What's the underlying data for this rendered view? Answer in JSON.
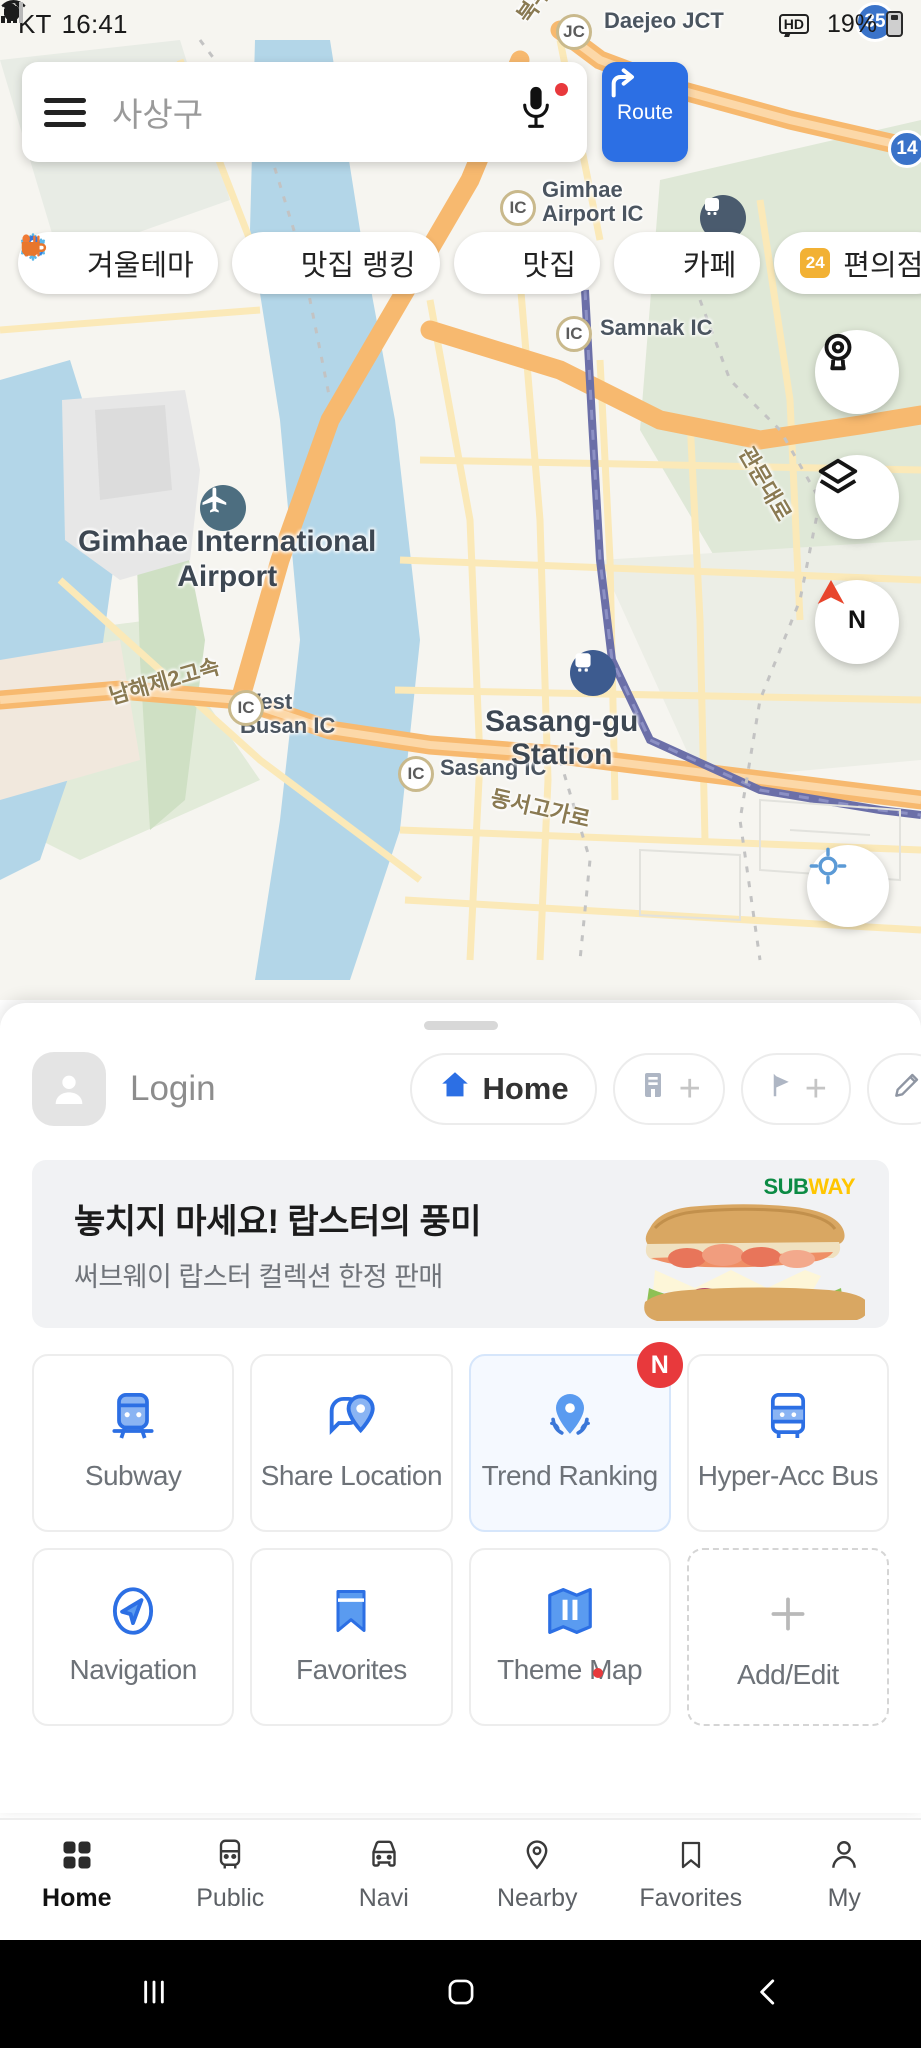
{
  "status_bar": {
    "carrier": "KT",
    "time": "16:41",
    "hd_label": "HD",
    "battery_percent": "19%",
    "icons": [
      "alarm-icon",
      "mute-icon",
      "location-icon",
      "wifi-icon",
      "hd-icon",
      "signal-icon"
    ]
  },
  "search": {
    "menu_icon": "hamburger-menu-icon",
    "value": "사상구",
    "placeholder": "사상구",
    "mic_icon": "microphone-icon",
    "has_notification_dot": true
  },
  "route_button": {
    "label": "Route",
    "icon": "route-arrow-icon",
    "color": "#2c6fe4"
  },
  "category_chips": [
    {
      "label": "겨울테마",
      "icon": "snowflake-icon",
      "color": "#5bb7ea"
    },
    {
      "label": "맛집 랭킹",
      "icon": "ranking-pin-icon",
      "color": "#3b77d8"
    },
    {
      "label": "맛집",
      "icon": "cutlery-icon",
      "color": "#f07a34"
    },
    {
      "label": "카페",
      "icon": "coffee-cup-icon",
      "color": "#e8762c"
    },
    {
      "label": "편의점",
      "icon": "convenience-24-icon",
      "color": "#f2b134"
    }
  ],
  "map_controls": [
    {
      "name": "street-view-button",
      "icon": "street-view-icon"
    },
    {
      "name": "map-layers-button",
      "icon": "layers-icon"
    },
    {
      "name": "compass-button",
      "icon": "compass-icon",
      "label": "N"
    },
    {
      "name": "my-location-button",
      "icon": "crosshair-icon"
    }
  ],
  "map_labels": [
    {
      "text": "Daejeo JCT",
      "type": "junction"
    },
    {
      "text": "Samnak IC",
      "type": "interchange"
    },
    {
      "text": "Gimhae Airport IC",
      "type": "interchange"
    },
    {
      "text": "Gimhae International Airport",
      "type": "poi"
    },
    {
      "text": "West Busan IC",
      "type": "interchange"
    },
    {
      "text": "Sasang IC",
      "type": "interchange"
    },
    {
      "text": "Sasang-gu Station",
      "type": "station"
    },
    {
      "text": "관문대로",
      "type": "road"
    },
    {
      "text": "남해제2고속",
      "type": "road"
    },
    {
      "text": "동서고가로",
      "type": "road"
    },
    {
      "text": "35",
      "type": "highway-badge"
    },
    {
      "text": "14",
      "type": "highway-badge"
    },
    {
      "text": "IC",
      "type": "ic-marker"
    }
  ],
  "sheet": {
    "drag_handle": "drag-handle",
    "user": {
      "login_label": "Login",
      "avatar_icon": "person-avatar-icon"
    },
    "quick_chips": [
      {
        "label": "Home",
        "icon": "home-icon",
        "type": "set"
      },
      {
        "label": "",
        "icon": "office-icon",
        "type": "add",
        "plus": "+"
      },
      {
        "label": "",
        "icon": "flag-icon",
        "type": "add",
        "plus": "+"
      },
      {
        "label": "",
        "icon": "pencil-edit-icon",
        "type": "edit"
      }
    ],
    "ad": {
      "title": "놓치지 마세요! 랍스터의 풍미",
      "subtitle": "써브웨이 랍스터 컬렉션 한정 판매",
      "brand_sub": "SUB",
      "brand_way": "WAY",
      "image": "lobster-sandwich-image"
    },
    "shortcuts": [
      {
        "label": "Subway",
        "icon": "subway-train-icon",
        "badge": "",
        "active": false,
        "dot": false
      },
      {
        "label": "Share Location",
        "icon": "share-location-icon",
        "badge": "",
        "active": false,
        "dot": false
      },
      {
        "label": "Trend Ranking",
        "icon": "trend-ranking-pin-icon",
        "badge": "N",
        "active": true,
        "dot": false
      },
      {
        "label": "Hyper-Acc Bus",
        "icon": "bus-icon",
        "badge": "",
        "active": false,
        "dot": false
      },
      {
        "label": "Navigation",
        "icon": "navigation-arrow-icon",
        "badge": "",
        "active": false,
        "dot": false
      },
      {
        "label": "Favorites",
        "icon": "bookmark-icon",
        "badge": "",
        "active": false,
        "dot": false
      },
      {
        "label": "Theme Map",
        "icon": "theme-map-icon",
        "badge": "",
        "active": false,
        "dot": true
      },
      {
        "label": "Add/Edit",
        "icon": "plus-icon",
        "badge": "",
        "active": false,
        "dot": false,
        "dashed": true
      }
    ]
  },
  "bottom_nav": [
    {
      "label": "Home",
      "icon": "grid-home-icon",
      "active": true
    },
    {
      "label": "Public",
      "icon": "bus-transit-icon",
      "active": false
    },
    {
      "label": "Navi",
      "icon": "car-icon",
      "active": false
    },
    {
      "label": "Nearby",
      "icon": "map-pin-icon",
      "active": false
    },
    {
      "label": "Favorites",
      "icon": "bookmark-icon",
      "active": false
    },
    {
      "label": "My",
      "icon": "person-icon",
      "active": false
    }
  ],
  "android_nav": [
    {
      "name": "recents-button",
      "icon": "recents-icon"
    },
    {
      "name": "home-button",
      "icon": "home-square-icon"
    },
    {
      "name": "back-button",
      "icon": "back-chevron-icon"
    }
  ],
  "colors": {
    "accent": "#2c6fe4",
    "badge_red": "#e8393c",
    "map_water": "#aed4e6",
    "map_land": "#f4f3ee",
    "map_road": "#f6c68a",
    "map_green": "#d9e5cf"
  }
}
